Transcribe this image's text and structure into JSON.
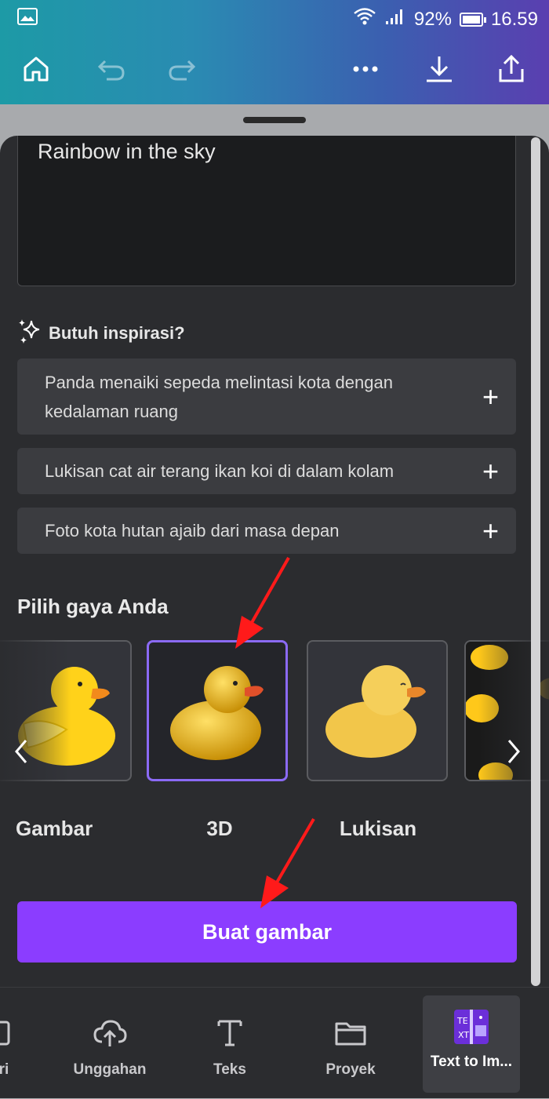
{
  "status_bar": {
    "battery_percent": "92%",
    "time": "16.59"
  },
  "toolbar": {
    "icons": [
      "home-icon",
      "undo-icon",
      "redo-icon",
      "more-icon",
      "download-icon",
      "share-icon"
    ]
  },
  "prompt": {
    "value": "Rainbow in the sky"
  },
  "inspiration": {
    "title": "Butuh inspirasi?",
    "suggestions": [
      "Panda menaiki sepeda melintasi kota dengan kedalaman ruang",
      "Lukisan cat air terang ikan koi di dalam kolam",
      "Foto kota hutan ajaib dari masa depan"
    ]
  },
  "styles": {
    "title": "Pilih gaya Anda",
    "options": [
      {
        "label": "Gambar",
        "selected": false
      },
      {
        "label": "3D",
        "selected": true
      },
      {
        "label": "Lukisan",
        "selected": false
      }
    ]
  },
  "generate_button": {
    "label": "Buat gambar"
  },
  "bottom_nav": {
    "items": [
      {
        "label": "ri",
        "icon": "square-icon"
      },
      {
        "label": "Unggahan",
        "icon": "cloud-upload-icon"
      },
      {
        "label": "Teks",
        "icon": "text-icon"
      },
      {
        "label": "Proyek",
        "icon": "folder-icon"
      },
      {
        "label": "Text to Im...",
        "icon": "text-to-image-icon",
        "active": true
      }
    ]
  },
  "colors": {
    "accent": "#8b3dff",
    "selected_border": "#8b6af5",
    "annotation_arrow": "#ff1a1a"
  }
}
